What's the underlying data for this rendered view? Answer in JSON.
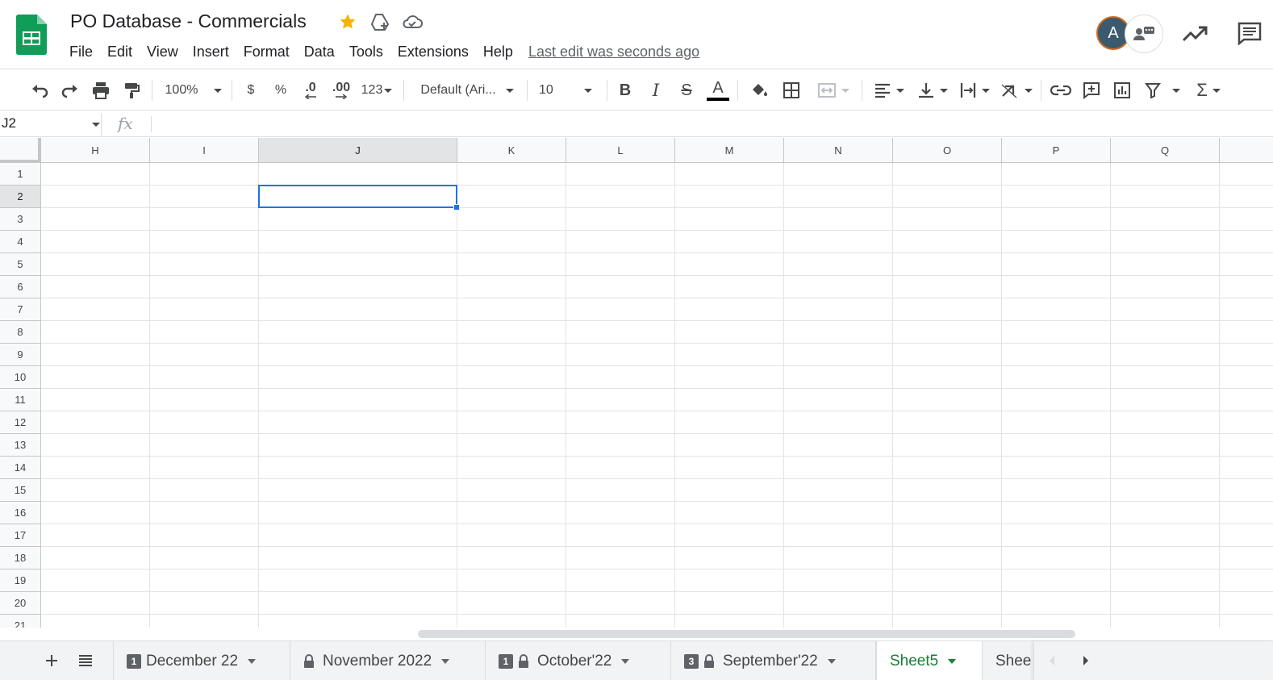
{
  "header": {
    "title": "PO Database - Commercials",
    "menu": [
      "File",
      "Edit",
      "View",
      "Insert",
      "Format",
      "Data",
      "Tools",
      "Extensions",
      "Help"
    ],
    "last_edit": "Last edit was seconds ago",
    "avatar_initial": "A",
    "star_color": "#f4b400",
    "brand_color": "#0f9d58"
  },
  "toolbar": {
    "zoom": "100%",
    "currency": "$",
    "percent": "%",
    "decrease_decimal": ".0",
    "increase_decimal": ".00",
    "number_format": "123",
    "font": "Default (Ari...",
    "font_size": "10"
  },
  "formula_bar": {
    "cell_ref": "J2",
    "fx": "fx",
    "value": ""
  },
  "grid": {
    "columns": [
      "H",
      "I",
      "J",
      "K",
      "L",
      "M",
      "N",
      "O",
      "P",
      "Q"
    ],
    "rows": [
      "1",
      "2",
      "3",
      "4",
      "5",
      "6",
      "7",
      "8",
      "9",
      "10",
      "11",
      "12",
      "13",
      "14",
      "15",
      "16",
      "17",
      "18",
      "19",
      "20",
      "21"
    ],
    "selected_column": "J",
    "selected_row": "2",
    "selection_color": "#1a73e8"
  },
  "sheets": {
    "tabs": [
      {
        "name": "December 22",
        "badge": "1",
        "locked": false
      },
      {
        "name": "November 2022",
        "badge": "",
        "locked": true
      },
      {
        "name": "October'22",
        "badge": "1",
        "locked": true
      },
      {
        "name": "September'22",
        "badge": "3",
        "locked": true
      },
      {
        "name": "Sheet5",
        "badge": "",
        "locked": false
      },
      {
        "name": "Shee",
        "badge": "",
        "locked": false
      }
    ],
    "active": "Sheet5",
    "active_color": "#188038"
  }
}
